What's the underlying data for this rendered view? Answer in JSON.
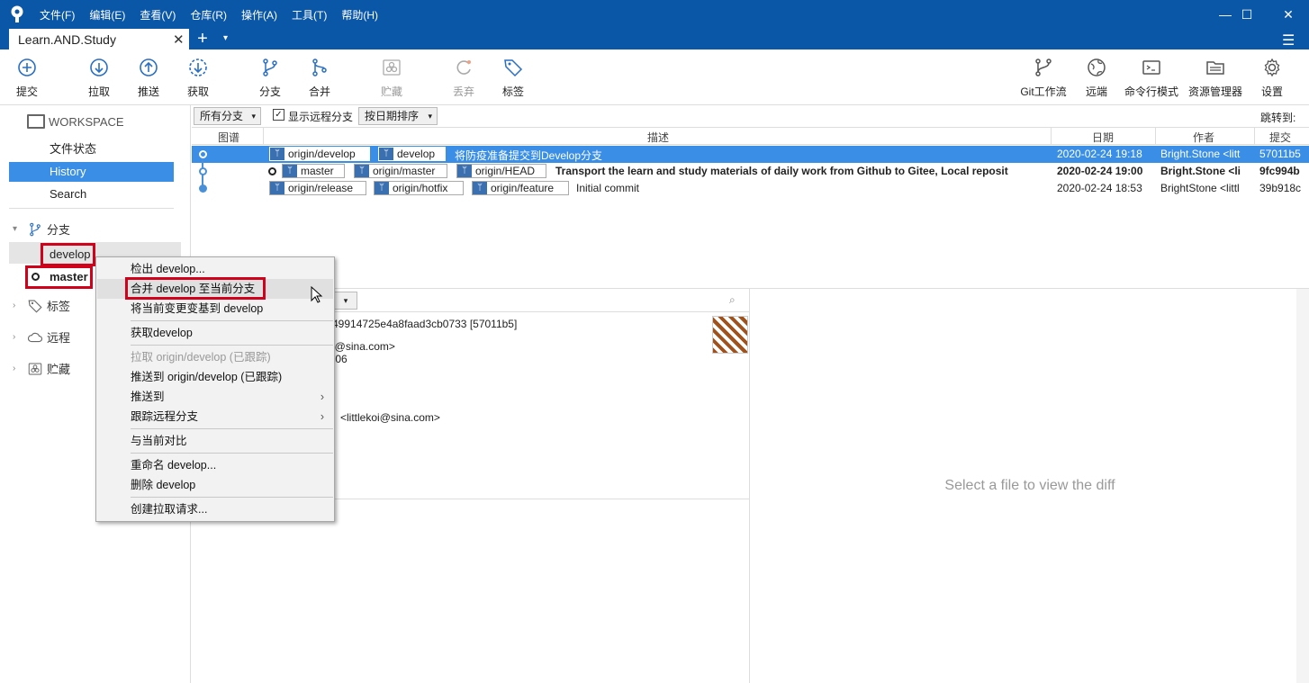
{
  "menu": [
    "文件(F)",
    "编辑(E)",
    "查看(V)",
    "仓库(R)",
    "操作(A)",
    "工具(T)",
    "帮助(H)"
  ],
  "tab": {
    "title": "Learn.AND.Study",
    "close": "✕",
    "new": "+",
    "list": "▾"
  },
  "window_controls": {
    "minimize": "—",
    "maximize": "☐",
    "close": "✕",
    "hamburger": "☰"
  },
  "toolbar": {
    "left": [
      {
        "label": "提交",
        "icon": "plus-circle-icon",
        "disabled": false
      },
      {
        "label": "拉取",
        "icon": "arrow-down-circle-icon",
        "disabled": false
      },
      {
        "label": "推送",
        "icon": "arrow-up-circle-icon",
        "disabled": false
      },
      {
        "label": "获取",
        "icon": "fetch-dashed-circle-icon",
        "disabled": false
      },
      {
        "label": "分支",
        "icon": "branch-icon",
        "disabled": false
      },
      {
        "label": "合并",
        "icon": "merge-icon",
        "disabled": false
      },
      {
        "label": "贮藏",
        "icon": "stash-icon",
        "disabled": true
      },
      {
        "label": "丢弃",
        "icon": "discard-icon",
        "disabled": true
      },
      {
        "label": "标签",
        "icon": "tag-icon",
        "disabled": false
      }
    ],
    "right": [
      {
        "label": "Git工作流",
        "icon": "git-flow-icon"
      },
      {
        "label": "远端",
        "icon": "globe-icon"
      },
      {
        "label": "命令行模式",
        "icon": "terminal-icon"
      },
      {
        "label": "资源管理器",
        "icon": "folder-icon"
      },
      {
        "label": "设置",
        "icon": "gear-icon"
      }
    ]
  },
  "sidebar": {
    "workspace": "WORKSPACE",
    "items": [
      "文件状态",
      "History",
      "Search"
    ],
    "selected": "History",
    "branches_label": "分支",
    "branches": [
      "develop",
      "master"
    ],
    "tags_label": "标签",
    "remotes_label": "远程",
    "stashes_label": "贮藏"
  },
  "filter": {
    "branches": "所有分支",
    "show_remote": "显示远程分支",
    "show_remote_checked": true,
    "sort": "按日期排序",
    "jump": "跳转到:"
  },
  "columns": [
    "图谱",
    "描述",
    "日期",
    "作者",
    "提交"
  ],
  "commits": [
    {
      "tags": [
        "origin/develop",
        "develop"
      ],
      "message": "将防疫准备提交到Develop分支",
      "date": "2020-02-24 19:18",
      "author": "Bright.Stone <litt",
      "hash": "57011b5",
      "selected": true,
      "bold": false
    },
    {
      "tags": [
        "master",
        "origin/master",
        "origin/HEAD"
      ],
      "message": "Transport the learn and study materials of daily work from Github to Gitee,  Local reposit",
      "date": "2020-02-24 19:00",
      "author": "Bright.Stone <li",
      "hash": "9fc994b",
      "selected": false,
      "bold": true
    },
    {
      "tags": [
        "origin/release",
        "origin/hotfix",
        "origin/feature"
      ],
      "message": "Initial commit",
      "date": "2020-02-24 18:53",
      "author": "BrightStone <littl",
      "hash": "39b918c",
      "selected": false,
      "bold": false
    }
  ],
  "detail": {
    "hash_line": "49914725e4a8faad3cb0733 [57011b5]",
    "email_line": "i@sina.com>",
    "time_line": ":06",
    "committer_email": "<littlekoi@sina.com>"
  },
  "diff_placeholder": "Select a file to view the diff",
  "context_menu": [
    {
      "label": "检出 develop...",
      "disabled": false
    },
    {
      "label": "合并 develop 至当前分支",
      "disabled": false,
      "highlighted": true
    },
    {
      "label": "将当前变更变基到 develop",
      "disabled": false
    },
    {
      "label": "获取develop",
      "disabled": false
    },
    {
      "label": "拉取 origin/develop (已跟踪)",
      "disabled": true
    },
    {
      "label": "推送到 origin/develop (已跟踪)",
      "disabled": false
    },
    {
      "label": "推送到",
      "disabled": false,
      "submenu": true
    },
    {
      "label": "跟踪远程分支",
      "disabled": false,
      "submenu": true
    },
    {
      "label": "与当前对比",
      "disabled": false
    },
    {
      "label": "重命名 develop...",
      "disabled": false
    },
    {
      "label": "删除 develop",
      "disabled": false
    },
    {
      "label": "创建拉取请求...",
      "disabled": false
    }
  ],
  "colors": {
    "titlebar": "#0a57a8",
    "selection": "#3a8ee6",
    "highlight_box": "#d0021b",
    "graph": "#4a90d9"
  }
}
